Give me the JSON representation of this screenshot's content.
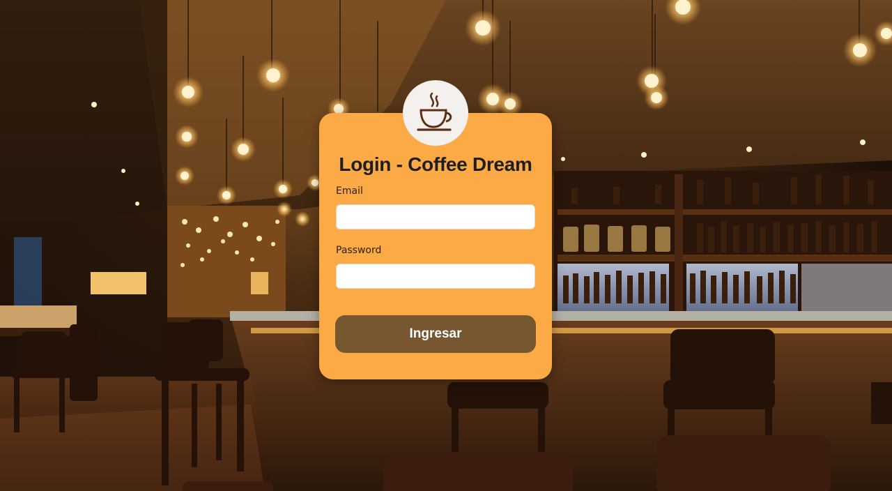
{
  "login": {
    "title": "Login - Coffee Dream",
    "email_label": "Email",
    "email_value": "",
    "password_label": "Password",
    "password_value": "",
    "submit_label": "Ingresar"
  },
  "colors": {
    "card": "#fbaa45",
    "button": "#76572f",
    "logo_bg": "#f4f0ee",
    "logo_icon": "#5a2f16"
  },
  "icons": {
    "logo": "coffee-cup-icon"
  }
}
